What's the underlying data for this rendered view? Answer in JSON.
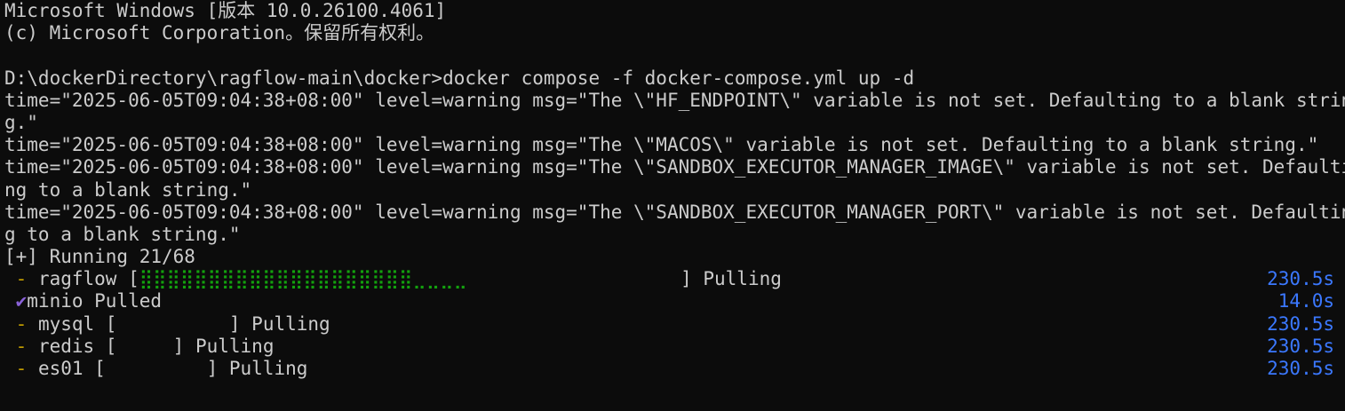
{
  "header": {
    "line1": "Microsoft Windows [版本 10.0.26100.4061]",
    "line2": "(c) Microsoft Corporation。保留所有权利。"
  },
  "command": {
    "prompt": "D:\\dockerDirectory\\ragflow-main\\docker>",
    "text": "docker compose -f docker-compose.yml up -d"
  },
  "warnings": [
    {
      "line_a": "time=\"2025-06-05T09:04:38+08:00\" level=warning msg=\"The \\\"HF_ENDPOINT\\\" variable is not set. Defaulting to a blank strin",
      "line_b": "g.\""
    },
    {
      "line_a": "time=\"2025-06-05T09:04:38+08:00\" level=warning msg=\"The \\\"MACOS\\\" variable is not set. Defaulting to a blank string.\""
    },
    {
      "line_a": "time=\"2025-06-05T09:04:38+08:00\" level=warning msg=\"The \\\"SANDBOX_EXECUTOR_MANAGER_IMAGE\\\" variable is not set. Defaulti",
      "line_b": "ng to a blank string.\""
    },
    {
      "line_a": "time=\"2025-06-05T09:04:38+08:00\" level=warning msg=\"The \\\"SANDBOX_EXECUTOR_MANAGER_PORT\\\" variable is not set. Defaultin",
      "line_b": "g to a blank string.\""
    }
  ],
  "running": "[+] Running 21/68",
  "services": [
    {
      "marker": " - ",
      "prefix": "ragflow [",
      "bar_filled": "⣿⣿⣿⣿⣿⣿⣿⣿⣿⣿⣿⣿⣿⣿⣿⣿⣿⣿⣿⣿⣀⣀⣀⣀",
      "bar_empty": "                   ",
      "suffix": "] Pulling",
      "time": "230.5s"
    },
    {
      "marker": " ✔",
      "prefix": "minio Pulled",
      "time": "14.0s"
    },
    {
      "marker": " - ",
      "prefix": "mysql [",
      "bar_empty": "          ",
      "suffix": "] Pulling",
      "time": "230.5s"
    },
    {
      "marker": " - ",
      "prefix": "redis [",
      "bar_empty": "     ",
      "suffix": "] Pulling",
      "time": "230.5s"
    },
    {
      "marker": " - ",
      "prefix": "es01 [",
      "bar_empty": "         ",
      "suffix": "] Pulling",
      "time": "230.5s"
    }
  ],
  "colors": {
    "background": "#0c0c0c",
    "text": "#cccccc",
    "marker": "#c19c00",
    "check": "#8a62d8",
    "progress": "#13a10e",
    "time": "#3b78ff"
  }
}
